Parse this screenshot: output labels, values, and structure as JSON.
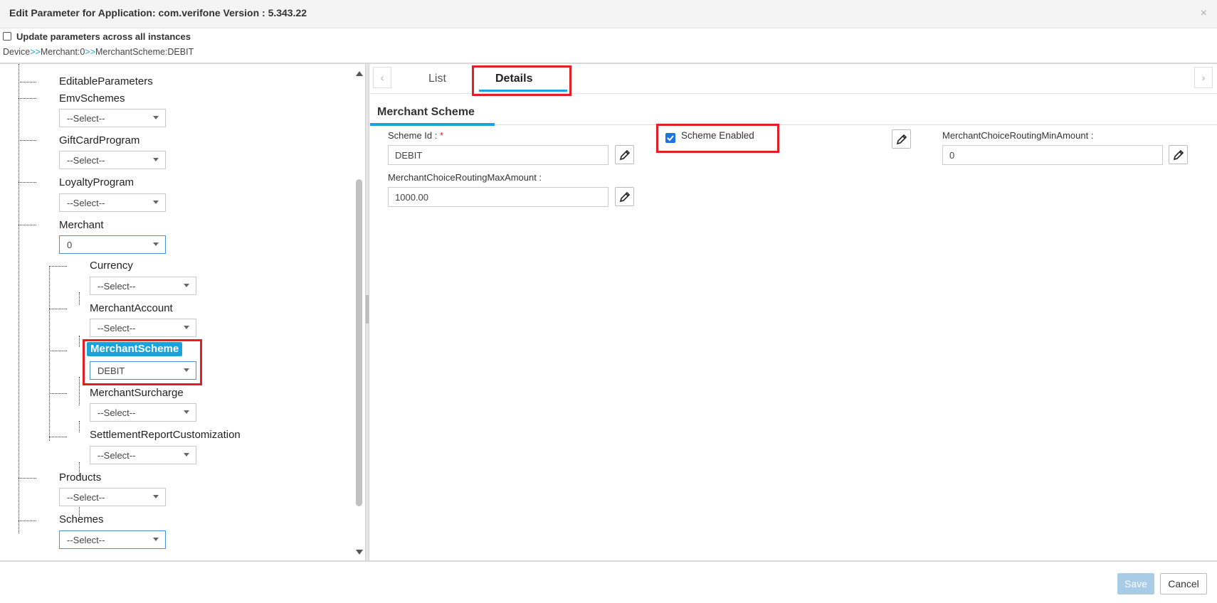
{
  "header": {
    "title": "Edit Parameter for Application: com.verifone Version : 5.343.22",
    "close": "×"
  },
  "update_all": {
    "label": "Update parameters across all instances",
    "checked": false
  },
  "breadcrumb": {
    "parts": [
      "Device",
      "Merchant:0",
      "MerchantScheme:DEBIT"
    ],
    "separator": ">>"
  },
  "tree": {
    "editable_parameters": "EditableParameters",
    "emv_schemes": {
      "label": "EmvSchemes",
      "value": "--Select--"
    },
    "gift_card_program": {
      "label": "GiftCardProgram",
      "value": "--Select--"
    },
    "loyalty_program": {
      "label": "LoyaltyProgram",
      "value": "--Select--"
    },
    "merchant": {
      "label": "Merchant",
      "value": "0"
    },
    "currency": {
      "label": "Currency",
      "value": "--Select--"
    },
    "merchant_account": {
      "label": "MerchantAccount",
      "value": "--Select--"
    },
    "merchant_scheme": {
      "label": "MerchantScheme",
      "value": "DEBIT"
    },
    "merchant_surcharge": {
      "label": "MerchantSurcharge",
      "value": "--Select--"
    },
    "settlement_report": {
      "label": "SettlementReportCustomization",
      "value": "--Select--"
    },
    "products": {
      "label": "Products",
      "value": "--Select--"
    },
    "schemes": {
      "label": "Schemes",
      "value": "--Select--"
    }
  },
  "tabs": {
    "prev": "‹",
    "next": "›",
    "list": "List",
    "details": "Details"
  },
  "details": {
    "section_title": "Merchant Scheme",
    "scheme_id_label": "Scheme Id :",
    "required_mark": "*",
    "scheme_id_value": "DEBIT",
    "scheme_enabled_label": "Scheme Enabled",
    "scheme_enabled": true,
    "min_amount_label": "MerchantChoiceRoutingMinAmount :",
    "min_amount_value": "0",
    "max_amount_label": "MerchantChoiceRoutingMaxAmount :",
    "max_amount_value": "1000.00"
  },
  "footer": {
    "save": "Save",
    "cancel": "Cancel"
  },
  "colors": {
    "accent": "#1aa3db",
    "highlight_box": "#e31e24",
    "checkbox": "#1a73e8"
  }
}
